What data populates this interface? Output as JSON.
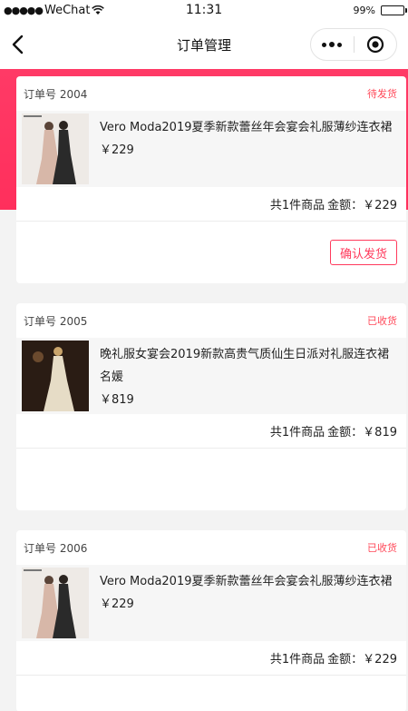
{
  "status_bar": {
    "carrier": "WeChat",
    "time": "11:31",
    "battery": "99%"
  },
  "nav": {
    "title": "订单管理"
  },
  "colors": {
    "accent": "#ff3a5c",
    "band": "#ff2f5c"
  },
  "orders": [
    {
      "order_no": "订单号 2004",
      "status": "待发货",
      "product_name": "Vero Moda2019夏季新款蕾丝年会宴会礼服薄纱连衣裙",
      "product_price": "￥229",
      "summary_count": "共1件商品",
      "summary_amount": "金额：￥229",
      "action_label": "确认发货"
    },
    {
      "order_no": "订单号 2005",
      "status": "已收货",
      "product_name": "晚礼服女宴会2019新款高贵气质仙生日派对礼服连衣裙名媛",
      "product_price": "￥819",
      "summary_count": "共1件商品",
      "summary_amount": "金额：￥819"
    },
    {
      "order_no": "订单号 2006",
      "status": "已收货",
      "product_name": "Vero Moda2019夏季新款蕾丝年会宴会礼服薄纱连衣裙",
      "product_price": "￥229",
      "summary_count": "共1件商品",
      "summary_amount": "金额：￥229"
    }
  ]
}
